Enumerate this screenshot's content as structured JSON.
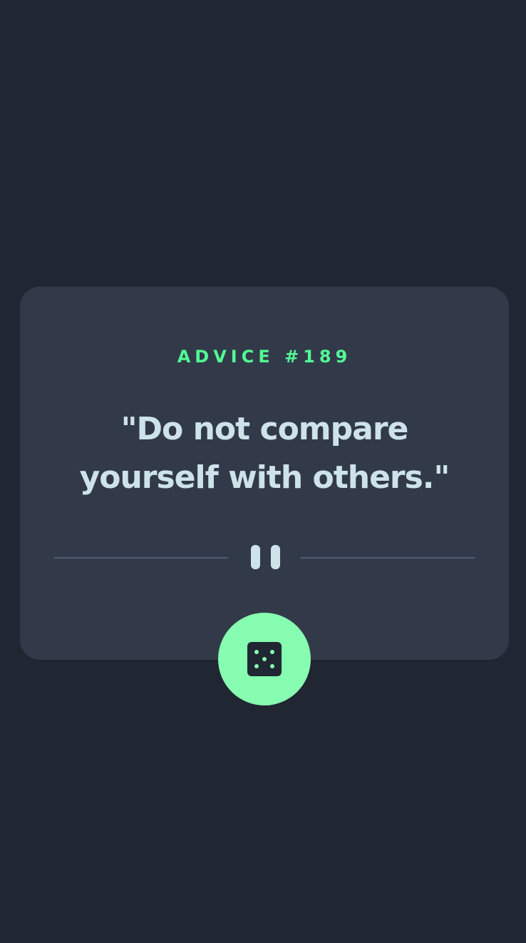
{
  "advice": {
    "label": "ADVICE #189",
    "quote": "\"Do not compare yourself with others.\""
  },
  "divider": {
    "icon": "pause-icon"
  },
  "dice_button": {
    "icon": "dice-icon"
  },
  "colors": {
    "background": "#202632",
    "card": "#323a49",
    "accent": "#53f995",
    "button": "#86fdb0",
    "text": "#cee3e9",
    "divider": "#4f5d74"
  }
}
